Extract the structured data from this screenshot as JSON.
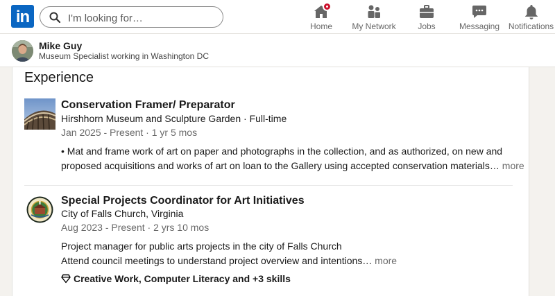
{
  "nav": {
    "logo_text": "in",
    "search_placeholder": "I'm looking for…",
    "items": [
      {
        "label": "Home",
        "icon": "home-icon",
        "badge": true
      },
      {
        "label": "My Network",
        "icon": "network-icon"
      },
      {
        "label": "Jobs",
        "icon": "briefcase-icon"
      },
      {
        "label": "Messaging",
        "icon": "messaging-icon"
      },
      {
        "label": "Notifications",
        "icon": "bell-icon"
      }
    ]
  },
  "profile": {
    "name": "Mike Guy",
    "headline": "Museum Specialist working in Washington DC"
  },
  "experience": {
    "title": "Experience",
    "items": [
      {
        "title": "Conservation Framer/ Preparator",
        "org": "Hirshhorn Museum and Sculpture Garden · Full-time",
        "dates": "Jan 2025 - Present · 1 yr 5 mos",
        "desc_line1": "• Mat and frame work of art on paper and photographs in the collection, and as authorized, on new and",
        "desc_line2": "proposed acquisitions and works of art on loan to the Gallery using accepted conservation materials…",
        "more": "more"
      },
      {
        "title": "Special Projects Coordinator for Art Initiatives",
        "org": "City of Falls Church, Virginia",
        "dates": "Aug 2023 - Present · 2 yrs 10 mos",
        "desc_line1": "Project manager for public arts projects in the city of Falls Church",
        "desc_line2": "Attend council meetings to understand project overview and intentions…",
        "more": "more",
        "skills": "Creative Work, Computer Literacy and +3 skills"
      }
    ]
  },
  "colors": {
    "brand": "#0a66c2",
    "badge": "#cb112d",
    "nav_text": "#666666",
    "page_bg": "#f4f2ee"
  }
}
